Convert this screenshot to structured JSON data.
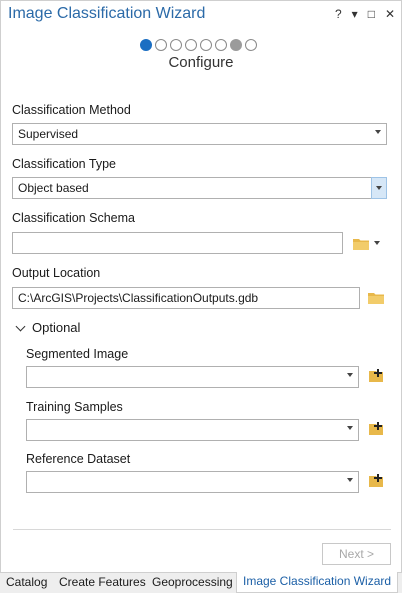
{
  "pane": {
    "title": "Image Classification Wizard",
    "actions": {
      "help": "?",
      "menu": "▾",
      "restore": "□",
      "close": "✕"
    }
  },
  "wizard": {
    "steps_total": 8,
    "current_step": 1,
    "disabled_step": 7,
    "step_title": "Configure"
  },
  "form": {
    "classification_method": {
      "label": "Classification Method",
      "value": "Supervised"
    },
    "classification_type": {
      "label": "Classification Type",
      "value": "Object based"
    },
    "classification_schema": {
      "label": "Classification Schema",
      "value": ""
    },
    "output_location": {
      "label": "Output Location",
      "value": "C:\\ArcGIS\\Projects\\ClassificationOutputs.gdb"
    }
  },
  "optional": {
    "header": "Optional",
    "segmented_image": {
      "label": "Segmented Image",
      "value": ""
    },
    "training_samples": {
      "label": "Training Samples",
      "value": ""
    },
    "reference_dataset": {
      "label": "Reference Dataset",
      "value": ""
    }
  },
  "footer": {
    "next_label": "Next >"
  },
  "tabs": [
    {
      "label": "Catalog",
      "active": false
    },
    {
      "label": "Create Features",
      "active": false
    },
    {
      "label": "Geoprocessing",
      "active": false
    },
    {
      "label": "Image Classification Wizard",
      "active": true
    }
  ],
  "colors": {
    "title": "#2b6aa8",
    "accent": "#1b6ec2",
    "folder": "#e8b84a"
  }
}
